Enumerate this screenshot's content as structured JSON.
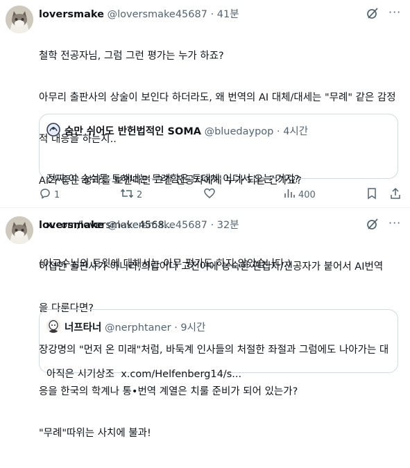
{
  "tweets": [
    {
      "name": "loversmake",
      "handle": "@loversmake45687",
      "sep": "·",
      "time": "41분",
      "lines": [
        "철학 전공자님, 그럼 그런 평가는 누가 하죠?",
        "아무리 출판사의 상술이 보인다 하더라도, 왜 번역의 AI 대체/대세는 \"무례\" 같은 감정",
        "적 대응을 하는지..",
        "AI가 좋은 성과를 보인다면 그건 전공자에게 누가 되는 건가요?",
        "",
        "(이교수님의 트윗에 대해서는 아무 평가도 하지 않았습니다.)"
      ],
      "quote": {
        "name": "숨만 쉬어도 반헌법적인 SOMA",
        "handle": "@bluedaypop",
        "sep": "·",
        "time": "4시간",
        "lines": [
          "진짜 이 숨쉬듯 토해내는 무례함은 도대체 어디서 오는 거지?",
          "x.com/loversmake4568..."
        ]
      },
      "actions": {
        "replies": "1",
        "retweets": "2",
        "likes": "",
        "views": "400"
      }
    },
    {
      "name": "loversmake",
      "handle": "@loversmake45687",
      "sep": "·",
      "time": "32분",
      "lines": [
        "허접한 출판사가 아니라,희랍어나 고전어에 능숙한 편집자/전공자가 붙어서 AI번역",
        "을 다룬다면?",
        "장강명의 \"먼저 온 미래\"처럼, 바둑계 인사들의 처절한 좌절과 그럼에도 나아가는 대",
        "응을 한국의 학계나 통•번역 계열은 치룰 준비가 되어 있는가?",
        "\"무례\"따위는 사치에 불과!"
      ],
      "quote": {
        "name": "너프타너",
        "handle": "@nerphtaner",
        "sep": "·",
        "time": "9시간",
        "lines": [
          "아직은 시기상조  x.com/Helfenberg14/s..."
        ]
      }
    }
  ],
  "icons": [
    "grok-icon",
    "more-icon",
    "reply-icon",
    "retweet-icon",
    "like-icon",
    "views-icon",
    "bookmark-icon",
    "share-icon"
  ]
}
